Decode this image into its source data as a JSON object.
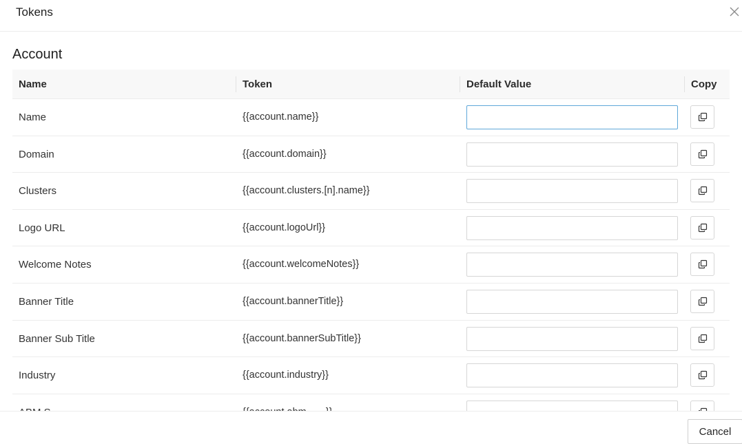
{
  "dialog": {
    "title": "Tokens",
    "cancel_label": "Cancel"
  },
  "section": {
    "title": "Account"
  },
  "columns": {
    "name": "Name",
    "token": "Token",
    "default_value": "Default Value",
    "copy": "Copy"
  },
  "rows": [
    {
      "name": "Name",
      "token": "{{account.name}}",
      "default_value": ""
    },
    {
      "name": "Domain",
      "token": "{{account.domain}}",
      "default_value": ""
    },
    {
      "name": "Clusters",
      "token": "{{account.clusters.[n].name}}",
      "default_value": ""
    },
    {
      "name": "Logo URL",
      "token": "{{account.logoUrl}}",
      "default_value": ""
    },
    {
      "name": "Welcome Notes",
      "token": "{{account.welcomeNotes}}",
      "default_value": ""
    },
    {
      "name": "Banner Title",
      "token": "{{account.bannerTitle}}",
      "default_value": ""
    },
    {
      "name": "Banner Sub Title",
      "token": "{{account.bannerSubTitle}}",
      "default_value": ""
    },
    {
      "name": "Industry",
      "token": "{{account.industry}}",
      "default_value": ""
    },
    {
      "name": "ABM S...",
      "token": "{{account.abm.......}}",
      "default_value": ""
    }
  ],
  "icons": {
    "close": "close-icon",
    "copy": "copy-icon"
  },
  "colors": {
    "focus_border": "#5ea7d9",
    "header_bg": "#f8f8f8"
  }
}
